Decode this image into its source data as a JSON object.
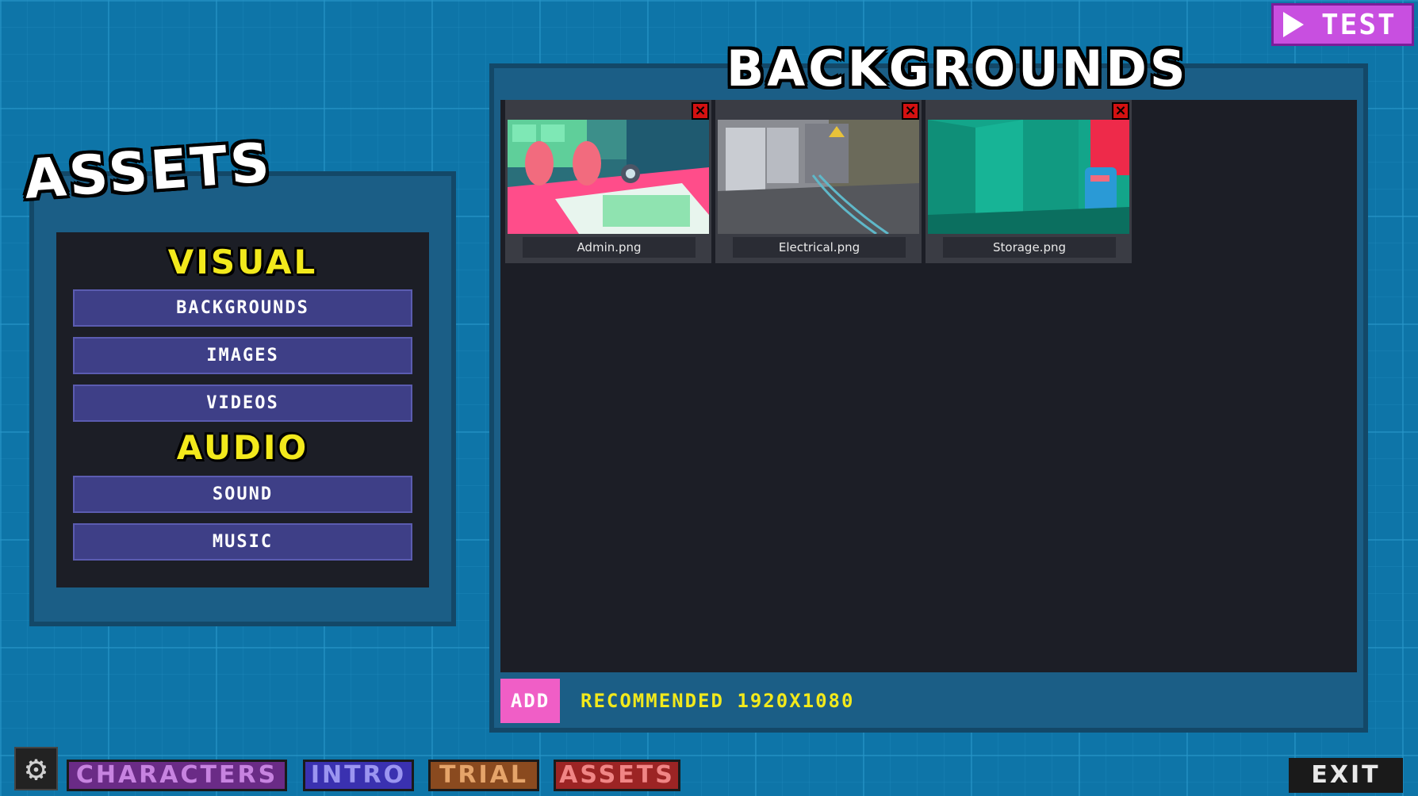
{
  "header": {
    "test_label": "TEST"
  },
  "assets_panel": {
    "title": "ASSETS",
    "visual_heading": "VISUAL",
    "audio_heading": "AUDIO",
    "visual_items": [
      "BACKGROUNDS",
      "IMAGES",
      "VIDEOS"
    ],
    "audio_items": [
      "SOUND",
      "MUSIC"
    ]
  },
  "backgrounds_panel": {
    "title": "BACKGROUNDS",
    "items": [
      {
        "name": "Admin.png"
      },
      {
        "name": "Electrical.png"
      },
      {
        "name": "Storage.png"
      }
    ],
    "add_label": "ADD",
    "recommended_text": "RECOMMENDED 1920X1080"
  },
  "bottom_bar": {
    "tabs": [
      "CHARACTERS",
      "INTRO",
      "TRIAL",
      "ASSETS"
    ],
    "exit_label": "EXIT"
  },
  "icons": {
    "play": "play-icon",
    "gear": "gear-icon",
    "close": "close-icon"
  },
  "colors": {
    "background": "#0e75a8",
    "panel": "#1b5e86",
    "panel_inner": "#1c1e26",
    "menu_button": "#3e3f87",
    "accent_yellow": "#f2e91c",
    "add_pink": "#f05ec6",
    "test_purple": "#c84fe0"
  }
}
